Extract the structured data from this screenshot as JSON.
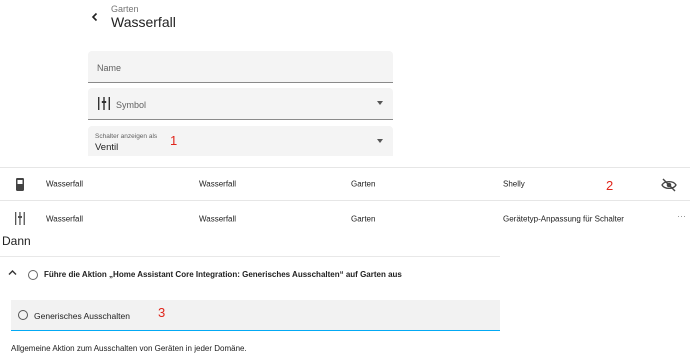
{
  "header": {
    "subtitle": "Garten",
    "title": "Wasserfall"
  },
  "form": {
    "name_label": "Name",
    "symbol_label": "Symbol",
    "switch_label": "Schalter anzeigen als",
    "switch_value": "Ventil"
  },
  "annotations": {
    "one": "1",
    "two": "2",
    "three": "3"
  },
  "entities": [
    {
      "icon": "battery-device-icon",
      "name": "Wasserfall",
      "entity": "Wasserfall",
      "area": "Garten",
      "integration": "Shelly",
      "action_icon": "eye-off-icon"
    },
    {
      "icon": "sliders-icon",
      "name": "Wasserfall",
      "entity": "Wasserfall",
      "area": "Garten",
      "integration": "Gerätetyp-Anpassung für Schalter",
      "action_text": "···"
    }
  ],
  "then": {
    "heading": "Dann",
    "action_text": "Führe die Aktion „Home Assistant Core Integration: Generisches Ausschalten“ auf Garten aus",
    "selected_action": "Generisches Ausschalten",
    "description": "Allgemeine Aktion zum Ausschalten von Geräten in jeder Domäne."
  },
  "colors": {
    "accent": "#03a9f4",
    "annotation": "#e0251b"
  }
}
